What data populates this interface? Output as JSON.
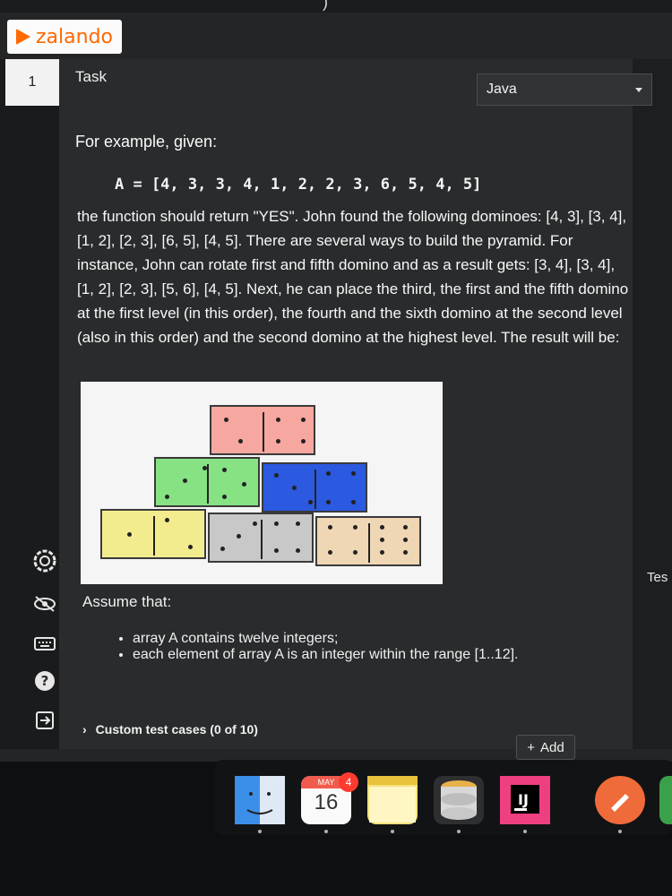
{
  "top": {
    "partial_text": ")"
  },
  "logo": {
    "text": "zalando"
  },
  "task": {
    "number": "1",
    "title": "Task",
    "language": "Java"
  },
  "content": {
    "example_intro": "For example, given:",
    "code": "A = [4, 3, 3, 4, 1, 2, 2, 3, 6, 5, 4, 5]",
    "paragraph": "the function should return \"YES\". John found the following dominoes: [4, 3], [3, 4], [1, 2], [2, 3], [6, 5], [4, 5]. There are several ways to build the pyramid. For instance, John can rotate first and fifth domino and as a result gets: [3, 4], [3, 4], [1, 2], [2, 3], [5, 6], [4, 5]. Next, he can place the third, the first and the fifth domino at the first level (in this order), the fourth and the sixth domino at the second level (also in this order) and the second domino at the highest level. The result will be:",
    "assume_title": "Assume that:",
    "bullets": [
      "array A contains twelve integers;",
      "each element of array A is an integer within the range [1..12]."
    ]
  },
  "custom_tests": {
    "label": "Custom test cases (0 of 10)",
    "add_label": "Add"
  },
  "right_panel": {
    "label": "Tes"
  },
  "dock": {
    "calendar_month": "MAY",
    "calendar_day": "16",
    "calendar_badge": "4",
    "ide_label": "IJ"
  },
  "colors": {
    "accent": "#ff6900",
    "domino_red": "#f6a7a0",
    "domino_green": "#86e283",
    "domino_blue": "#2b59e0",
    "domino_yellow": "#f3ec8f",
    "domino_gray": "#c8c8c8",
    "domino_tan": "#efd6b5"
  }
}
